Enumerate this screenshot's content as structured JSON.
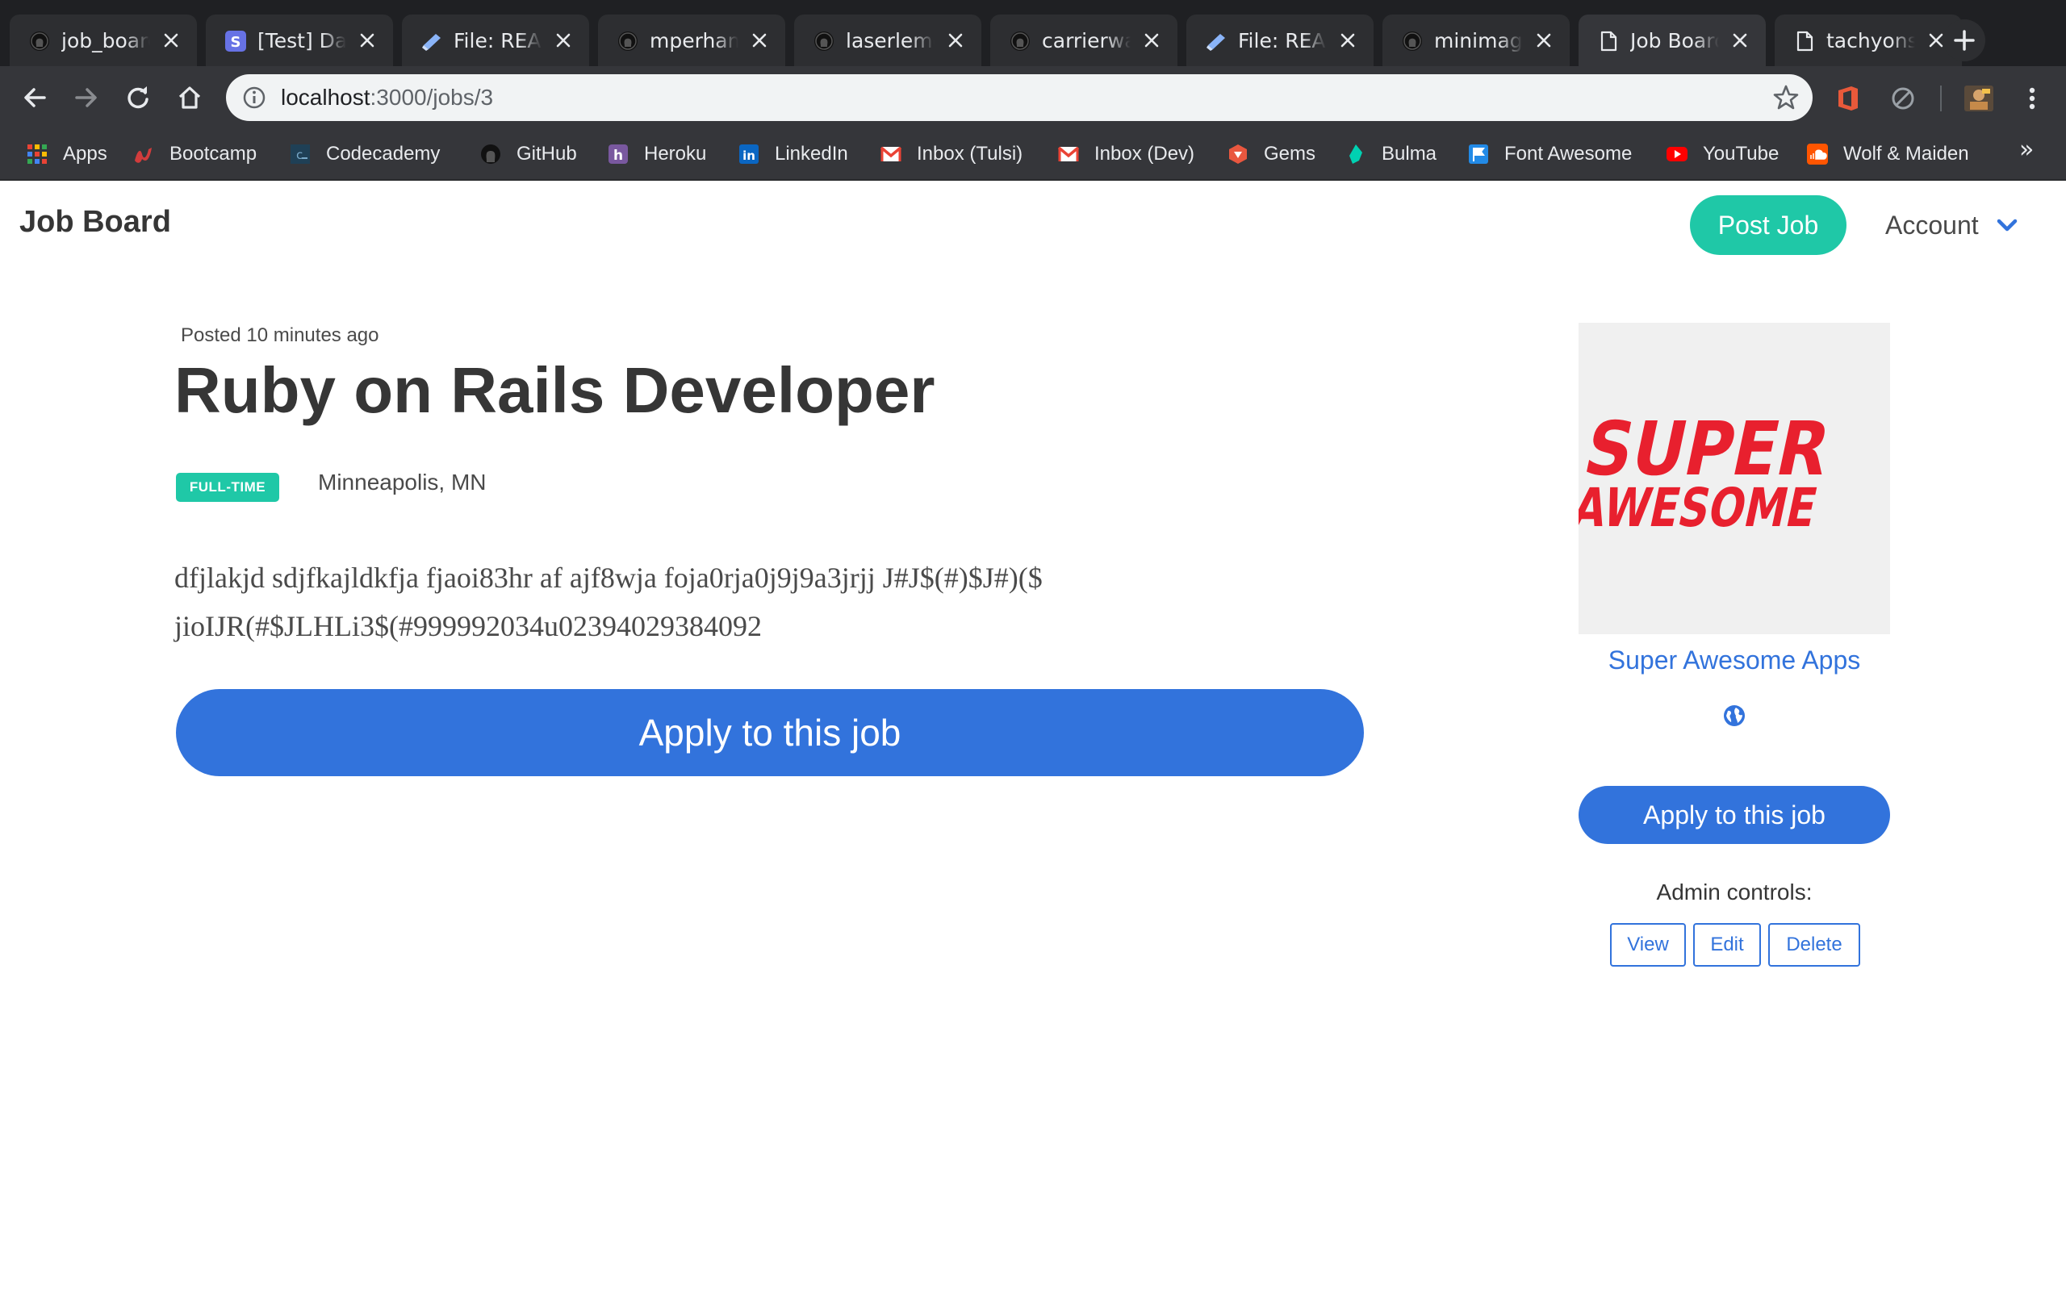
{
  "browser": {
    "tabs": [
      {
        "title": "job_board",
        "icon": "github-icon"
      },
      {
        "title": "[Test] Dashboard",
        "icon": "stripe-icon"
      },
      {
        "title": "File: README",
        "icon": "file-icon"
      },
      {
        "title": "mperham/sidekiq",
        "icon": "github-icon"
      },
      {
        "title": "laserlemon",
        "icon": "github-icon"
      },
      {
        "title": "carrierwave",
        "icon": "github-icon"
      },
      {
        "title": "File: README",
        "icon": "file-icon"
      },
      {
        "title": "minimagick",
        "icon": "github-icon"
      },
      {
        "title": "Job Board",
        "icon": "page-icon",
        "active": true
      },
      {
        "title": "tachyons",
        "icon": "page-icon"
      }
    ],
    "url_host": "localhost",
    "url_path": ":3000/jobs/3",
    "bookmarks": [
      {
        "label": "Apps",
        "icon": "apps-grid-icon"
      },
      {
        "label": "Bootcamp",
        "icon": "bootcamp-icon"
      },
      {
        "label": "Codecademy",
        "icon": "codecademy-icon"
      },
      {
        "label": "GitHub",
        "icon": "github-icon"
      },
      {
        "label": "Heroku",
        "icon": "heroku-icon"
      },
      {
        "label": "LinkedIn",
        "icon": "linkedin-icon"
      },
      {
        "label": "Inbox (Tulsi)",
        "icon": "gmail-icon"
      },
      {
        "label": "Inbox (Dev)",
        "icon": "gmail-icon"
      },
      {
        "label": "Gems",
        "icon": "rubygems-icon"
      },
      {
        "label": "Bulma",
        "icon": "bulma-icon"
      },
      {
        "label": "Font Awesome",
        "icon": "font-awesome-flag-icon"
      },
      {
        "label": "YouTube",
        "icon": "youtube-icon"
      },
      {
        "label": "Wolf & Maiden",
        "icon": "soundcloud-icon"
      }
    ],
    "bookmarks_overflow": "»"
  },
  "navbar": {
    "brand": "Job Board",
    "post_job": "Post Job",
    "account": "Account"
  },
  "job": {
    "posted": "Posted 10 minutes ago",
    "title": "Ruby on Rails Developer",
    "type_tag": "FULL-TIME",
    "location": "Minneapolis, MN",
    "description": "dfjlakjd sdjfkajldkfja fjaoi83hr af ajf8wja foja0rja0j9j9a3jrjj J#J$(#)$J#)($ jioIJR(#$JLHLi3$(#999992034u02394029384092",
    "apply_label": "Apply to this job"
  },
  "company": {
    "logo_line1": "SUPER",
    "logo_line2": "AWESOME",
    "name": "Super Awesome Apps",
    "apply_label": "Apply to this job"
  },
  "admin": {
    "label": "Admin controls:",
    "view": "View",
    "edit": "Edit",
    "delete": "Delete"
  },
  "colors": {
    "primary": "#3273dc",
    "accent": "#1fc8a7",
    "logo_red": "#e8202e"
  }
}
